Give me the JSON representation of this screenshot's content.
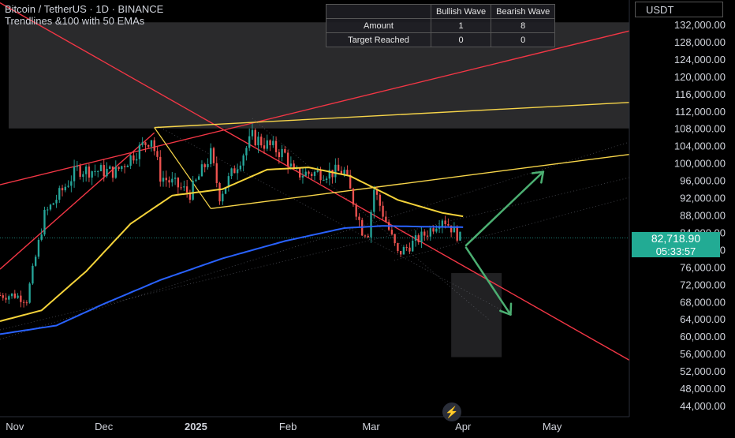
{
  "header": {
    "title": "Bitcoin / TetherUS · 1D · BINANCE",
    "subtitle": "Trendlines &100 with 50  EMAs"
  },
  "stats_table": {
    "columns": [
      "",
      "Bullish Wave",
      "Bearish Wave"
    ],
    "rows": [
      {
        "label": "Amount",
        "bullish": "1",
        "bearish": "8"
      },
      {
        "label": "Target Reached",
        "bullish": "0",
        "bearish": "0"
      }
    ]
  },
  "currency_button": "USDT",
  "current_price": "82,718.90",
  "countdown": "05:33:57",
  "colors": {
    "up": "#26a69a",
    "down": "#ef5350",
    "ema50": "#f5d33a",
    "ema200": "#2962ff",
    "red_line": "#f23645",
    "yellow_line": "#f7d54a",
    "arrow": "#4caf72"
  },
  "chart_data": {
    "type": "candlestick",
    "y_axis": {
      "min": 44000,
      "max": 132000,
      "ticks": [
        "132,000.00",
        "128,000.00",
        "124,000.00",
        "120,000.00",
        "116,000.00",
        "112,000.00",
        "108,000.00",
        "104,000.00",
        "100,000.00",
        "96,000.00",
        "92,000.00",
        "88,000.00",
        "84,000.00",
        "80,000.00",
        "76,000.00",
        "72,000.00",
        "68,000.00",
        "64,000.00",
        "60,000.00",
        "56,000.00",
        "52,000.00",
        "48,000.00",
        "44,000.00"
      ]
    },
    "x_axis": {
      "ticks": [
        "Nov",
        "Dec",
        "2025",
        "Feb",
        "Mar",
        "Apr",
        "May"
      ]
    },
    "x_dates": [
      "2024-11-01",
      "2024-12-01",
      "2025-01-01",
      "2025-02-01",
      "2025-03-01",
      "2025-04-01",
      "2025-05-01"
    ],
    "close_anchors": [
      {
        "date": "2024-11-01",
        "value": 69500
      },
      {
        "date": "2024-11-05",
        "value": 68500
      },
      {
        "date": "2024-11-11",
        "value": 88000
      },
      {
        "date": "2024-11-22",
        "value": 98500
      },
      {
        "date": "2024-12-05",
        "value": 98000
      },
      {
        "date": "2024-12-17",
        "value": 106000
      },
      {
        "date": "2024-12-20",
        "value": 97000
      },
      {
        "date": "2024-12-30",
        "value": 93000
      },
      {
        "date": "2025-01-06",
        "value": 102000
      },
      {
        "date": "2025-01-09",
        "value": 92500
      },
      {
        "date": "2025-01-20",
        "value": 106000
      },
      {
        "date": "2025-01-31",
        "value": 102000
      },
      {
        "date": "2025-02-03",
        "value": 97500
      },
      {
        "date": "2025-02-20",
        "value": 98000
      },
      {
        "date": "2025-02-26",
        "value": 84500
      },
      {
        "date": "2025-02-28",
        "value": 84000
      },
      {
        "date": "2025-03-02",
        "value": 94000
      },
      {
        "date": "2025-03-10",
        "value": 79000
      },
      {
        "date": "2025-03-20",
        "value": 84000
      },
      {
        "date": "2025-03-25",
        "value": 87500
      },
      {
        "date": "2025-03-31",
        "value": 82700
      }
    ],
    "ema50_anchors": [
      {
        "date": "2024-10-27",
        "value": 63500
      },
      {
        "date": "2024-11-10",
        "value": 66000
      },
      {
        "date": "2024-11-25",
        "value": 75000
      },
      {
        "date": "2024-12-10",
        "value": 86000
      },
      {
        "date": "2024-12-24",
        "value": 92500
      },
      {
        "date": "2025-01-10",
        "value": 94000
      },
      {
        "date": "2025-01-25",
        "value": 98500
      },
      {
        "date": "2025-02-08",
        "value": 99000
      },
      {
        "date": "2025-02-22",
        "value": 97000
      },
      {
        "date": "2025-03-10",
        "value": 91500
      },
      {
        "date": "2025-03-25",
        "value": 88500
      },
      {
        "date": "2025-04-01",
        "value": 87700
      }
    ],
    "ema200_anchors": [
      {
        "date": "2024-10-27",
        "value": 60500
      },
      {
        "date": "2024-11-15",
        "value": 62500
      },
      {
        "date": "2024-12-01",
        "value": 67500
      },
      {
        "date": "2024-12-20",
        "value": 73000
      },
      {
        "date": "2025-01-10",
        "value": 78000
      },
      {
        "date": "2025-01-31",
        "value": 82000
      },
      {
        "date": "2025-02-20",
        "value": 85000
      },
      {
        "date": "2025-03-05",
        "value": 85500
      },
      {
        "date": "2025-03-20",
        "value": 85300
      },
      {
        "date": "2025-04-01",
        "value": 85200
      }
    ],
    "trendlines": [
      {
        "name": "red-descending",
        "color": "red",
        "from": {
          "date": "2024-10-27",
          "value": 137000
        },
        "to": {
          "date": "2025-05-27",
          "value": 54500
        }
      },
      {
        "name": "red-ascending",
        "color": "red",
        "from": {
          "date": "2024-10-27",
          "value": 95000
        },
        "to": {
          "date": "2025-05-27",
          "value": 130500
        }
      },
      {
        "name": "red-lower-ascending",
        "color": "red",
        "from": {
          "date": "2024-10-27",
          "value": 75500
        },
        "to": {
          "date": "2024-12-18",
          "value": 107000
        }
      },
      {
        "name": "yellow-upper",
        "color": "yellow",
        "from": {
          "date": "2024-12-18",
          "value": 108200
        },
        "to": {
          "date": "2025-05-27",
          "value": 114000
        }
      },
      {
        "name": "yellow-lower",
        "color": "yellow",
        "from": {
          "date": "2025-01-06",
          "value": 89500
        },
        "to": {
          "date": "2025-05-27",
          "value": 102000
        }
      }
    ],
    "projections": [
      {
        "name": "bullish-target",
        "points": [
          {
            "date": "2025-04-02",
            "value": 81000
          },
          {
            "date": "2025-04-28",
            "value": 98000
          }
        ]
      },
      {
        "name": "bearish-target",
        "points": [
          {
            "date": "2025-04-02",
            "value": 80500
          },
          {
            "date": "2025-04-17",
            "value": 65000
          }
        ]
      }
    ],
    "shaded_zones": [
      {
        "name": "upper-zone",
        "from_date": "2024-10-27",
        "to_date": "2025-05-27",
        "low": 108000,
        "high": 132500
      },
      {
        "name": "lower-target-zone",
        "from_date": "2025-03-28",
        "to_date": "2025-04-14",
        "low": 55200,
        "high": 74600
      }
    ]
  }
}
